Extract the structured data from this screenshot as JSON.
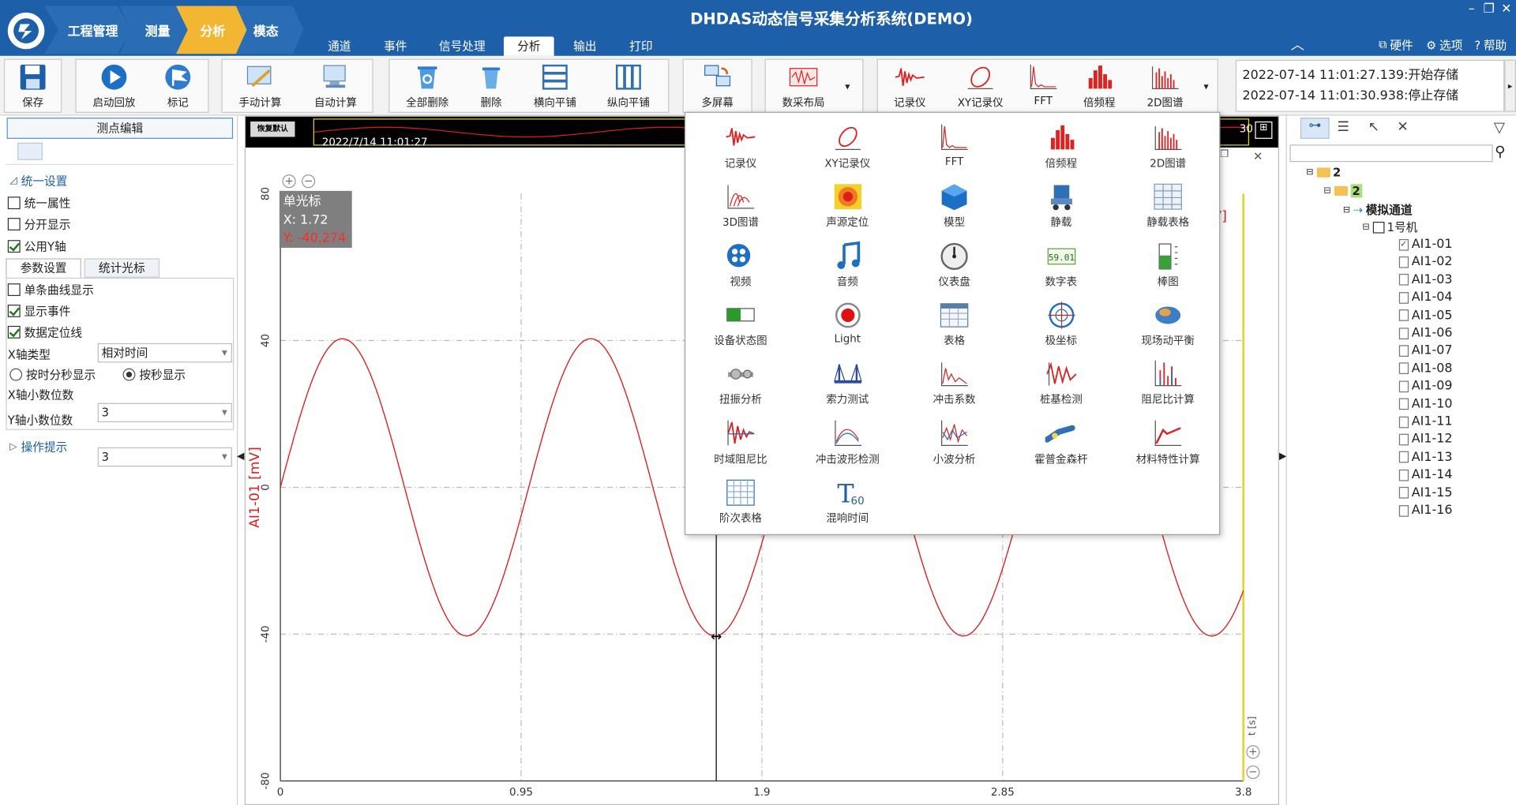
{
  "app_title": "DHDAS动态信号采集分析系统(DEMO)",
  "breadcrumbs": [
    "工程管理",
    "测量",
    "分析",
    "模态"
  ],
  "ribbon_tabs": [
    "通道",
    "事件",
    "信号处理",
    "分析",
    "输出",
    "打印"
  ],
  "active_tab": "分析",
  "top_right": {
    "hardware": "硬件",
    "options": "选项",
    "help": "帮助"
  },
  "toolbar": {
    "save": "保存",
    "playback": "启动回放",
    "mark": "标记",
    "manual_calc": "手动计算",
    "auto_calc": "自动计算",
    "delete_all": "全部删除",
    "delete": "删除",
    "tile_h": "横向平铺",
    "tile_v": "纵向平铺",
    "multiscreen": "多屏幕",
    "layout": "数采布局",
    "recorder": "记录仪",
    "xy_recorder": "XY记录仪",
    "fft": "FFT",
    "octave": "倍频程",
    "spectrum2d": "2D图谱"
  },
  "log_lines": [
    "2022-07-14 11:01:27.139:开始存储",
    "2022-07-14 11:01:30.938:停止存储"
  ],
  "left_panel": {
    "edit_button": "测点编辑",
    "unified_settings": "统一设置",
    "unified_props": "统一属性",
    "split_display": "分开显示",
    "common_y": "公用Y轴",
    "tabs": [
      "参数设置",
      "统计光标"
    ],
    "single_curve": "单条曲线显示",
    "show_events": "显示事件",
    "data_locator": "数据定位线",
    "x_axis_type_label": "X轴类型",
    "x_axis_type_value": "相对时间",
    "radio_hms": "按时分秒显示",
    "radio_sec": "按秒显示",
    "x_decimals_label": "X轴小数位数",
    "x_decimals_value": "3",
    "y_decimals_label": "Y轴小数位数",
    "y_decimals_value": "3",
    "hint": "操作提示"
  },
  "chart_header": {
    "restore": "恢复默认",
    "timestamp": "2022/7/14 11:01:27",
    "right_label": "30",
    "unit_clip": "V]"
  },
  "cursor": {
    "title": "单光标",
    "x": "X: 1.72",
    "y": "Y: -40.274"
  },
  "chart_data": {
    "type": "line",
    "series": [
      {
        "name": "AI1-01",
        "color": "#e01b1b"
      }
    ],
    "ylabel": "AI1-01 [mV]",
    "xlabel": "t [s]",
    "xlim": [
      0,
      3.8
    ],
    "ylim": [
      -80,
      80
    ],
    "xticks": [
      "0",
      "0.95",
      "1.9",
      "2.85",
      "3.8"
    ],
    "yticks": [
      "80",
      "40",
      "0",
      "-40",
      "-80"
    ],
    "amplitude": 40.5,
    "period": 0.98,
    "cursor_x": 1.72
  },
  "popup_items": [
    "记录仪",
    "XY记录仪",
    "FFT",
    "倍频程",
    "2D图谱",
    "3D图谱",
    "声源定位",
    "模型",
    "静载",
    "静载表格",
    "视频",
    "音频",
    "仪表盘",
    "数字表",
    "棒图",
    "设备状态图",
    "Light",
    "表格",
    "极坐标",
    "现场动平衡",
    "扭振分析",
    "索力测试",
    "冲击系数",
    "桩基检测",
    "阻尼比计算",
    "时域阻尼比",
    "冲击波形检测",
    "小波分析",
    "霍普金森杆",
    "材料特性计算",
    "阶次表格",
    "混响时间"
  ],
  "popup_icon_names": [
    "recorder-icon",
    "xy-recorder-icon",
    "fft-icon",
    "octave-icon",
    "spectrum2d-icon",
    "spectrum3d-icon",
    "sound-source-icon",
    "model-icon",
    "static-load-icon",
    "static-table-icon",
    "video-icon",
    "audio-icon",
    "gauge-icon",
    "digital-meter-icon",
    "bar-meter-icon",
    "device-status-icon",
    "light-icon",
    "table-icon",
    "polar-icon",
    "balance-icon",
    "torsion-icon",
    "cable-force-icon",
    "impact-icon",
    "pile-test-icon",
    "damping-calc-icon",
    "time-damping-icon",
    "shock-wave-icon",
    "wavelet-icon",
    "hopkinson-icon",
    "material-icon",
    "order-table-icon",
    "reverb-icon"
  ],
  "tree": {
    "root": "2",
    "child": "2",
    "group": "模拟通道",
    "device": "1号机",
    "channels": [
      "AI1-01",
      "AI1-02",
      "AI1-03",
      "AI1-04",
      "AI1-05",
      "AI1-06",
      "AI1-07",
      "AI1-08",
      "AI1-09",
      "AI1-10",
      "AI1-11",
      "AI1-12",
      "AI1-13",
      "AI1-14",
      "AI1-15",
      "AI1-16"
    ]
  }
}
